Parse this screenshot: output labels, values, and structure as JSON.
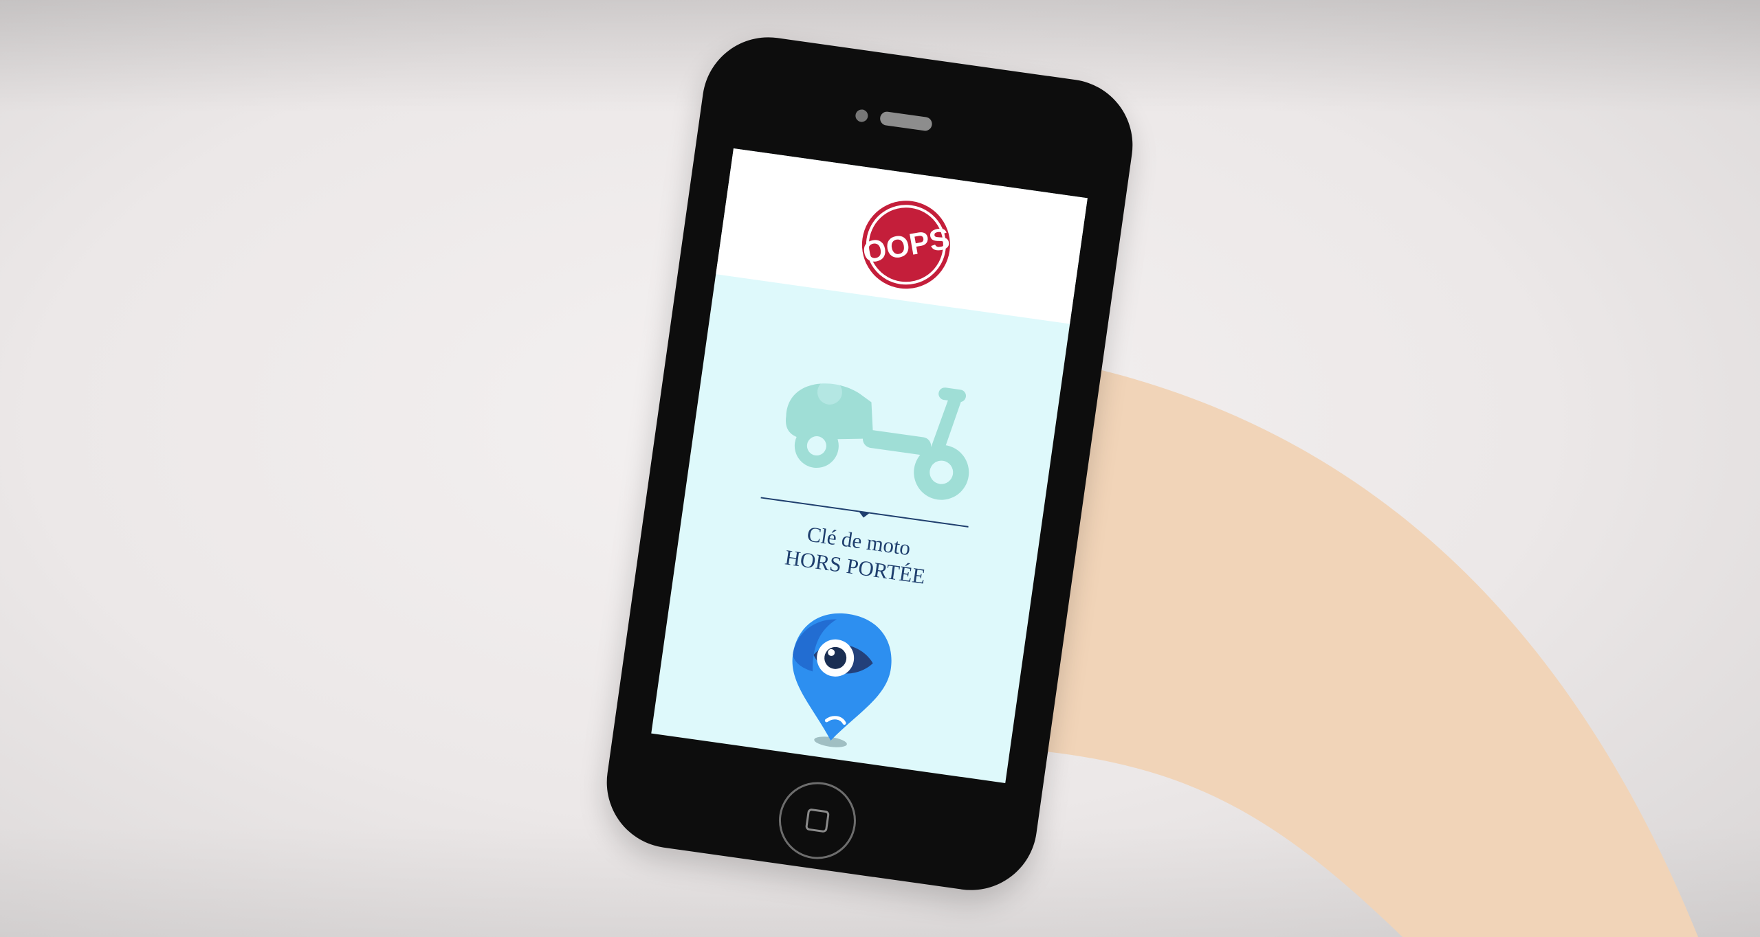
{
  "app": {
    "logo_text": "OOPS",
    "brand_color": "#c41e3a"
  },
  "screen": {
    "icon": "scooter-icon",
    "status_line1": "Clé de moto",
    "status_line2": "HORS PORTÉE",
    "bottom_icon": "location-eye-pin-icon"
  },
  "colors": {
    "screen_bg": "#def9fb",
    "scooter": "#9fded6",
    "text": "#1f3f6e",
    "pin": "#2d8ff0",
    "arm": "#f0d2b5"
  }
}
